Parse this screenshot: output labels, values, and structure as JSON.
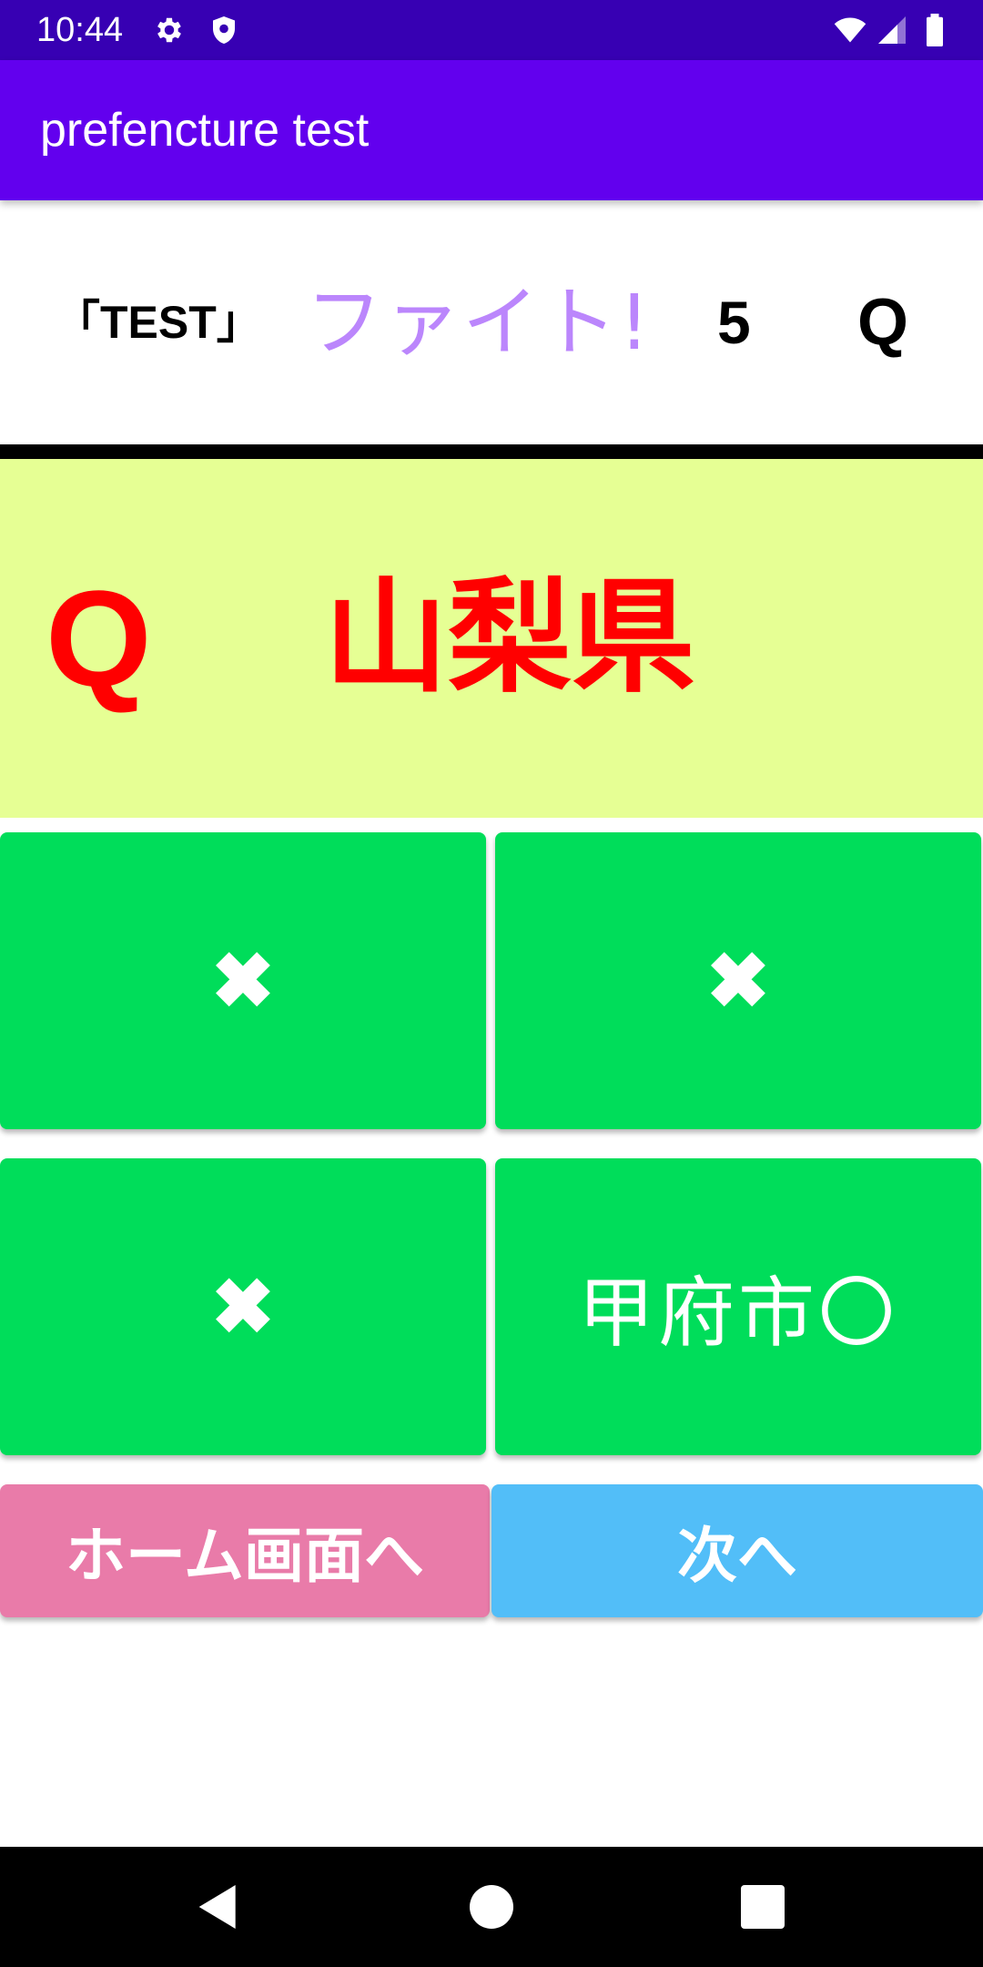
{
  "status_bar": {
    "time": "10:44",
    "icons_left": [
      "gear-icon",
      "shield-icon"
    ],
    "icons_right": [
      "wifi-icon",
      "signal-icon",
      "battery-icon"
    ]
  },
  "app_bar": {
    "title": "prefencture test",
    "color": "#6200ee"
  },
  "header": {
    "test_label": "「TEST」",
    "cheer": "ファイト!",
    "count": "5",
    "q_label": "Q"
  },
  "question": {
    "q_label": "Q",
    "prefecture": "山梨県",
    "background": "#e6ff94",
    "text_color": "#ff0000"
  },
  "answers": [
    {
      "label": "✖"
    },
    {
      "label": "✖"
    },
    {
      "label": "✖"
    },
    {
      "label": "甲府市〇"
    }
  ],
  "buttons": {
    "home": "ホーム画面へ",
    "next": "次へ"
  },
  "colors": {
    "answer_button": "#00dd5a",
    "home_button": "#e97ba9",
    "next_button": "#52bef8",
    "status_bar": "#3700b3"
  },
  "nav_bar": {
    "keys": [
      "back-icon",
      "home-icon",
      "recents-icon"
    ]
  }
}
